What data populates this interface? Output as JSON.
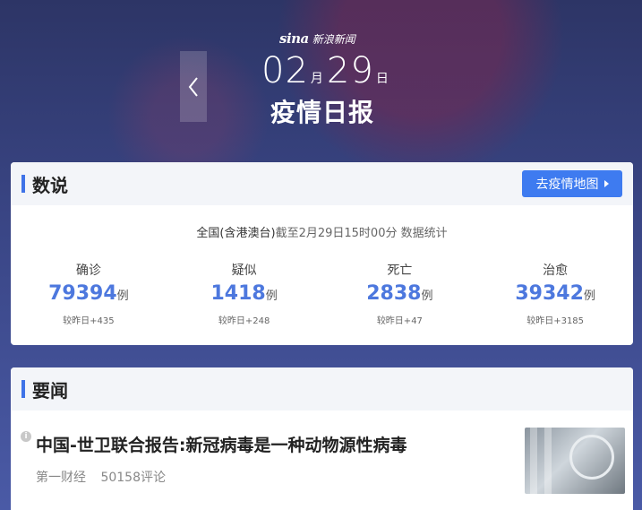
{
  "header": {
    "brand_logo": "sina",
    "brand_text": "新浪新闻",
    "month": "02",
    "month_unit": "月",
    "day": "29",
    "day_unit": "日",
    "title": "疫情日报",
    "prev_icon": "chevron-left-icon"
  },
  "stats_card": {
    "label": "数说",
    "map_button_label": "去疫情地图",
    "note_prefix": "全国(含港澳台)",
    "note_suffix": "截至2月29日15时00分 数据统计",
    "items": [
      {
        "label": "确诊",
        "value": "79394",
        "unit": "例",
        "delta": "较昨日+435"
      },
      {
        "label": "疑似",
        "value": "1418",
        "unit": "例",
        "delta": "较昨日+248"
      },
      {
        "label": "死亡",
        "value": "2838",
        "unit": "例",
        "delta": "较昨日+47"
      },
      {
        "label": "治愈",
        "value": "39342",
        "unit": "例",
        "delta": "较昨日+3185"
      }
    ],
    "accent_color": "#3f73e8",
    "value_color": "#4d78de"
  },
  "news_card": {
    "label": "要闻",
    "items": [
      {
        "title": "中国-世卫联合报告:新冠病毒是一种动物源性病毒",
        "source": "第一财经",
        "comments": "50158评论",
        "icon": "info-icon"
      }
    ]
  }
}
